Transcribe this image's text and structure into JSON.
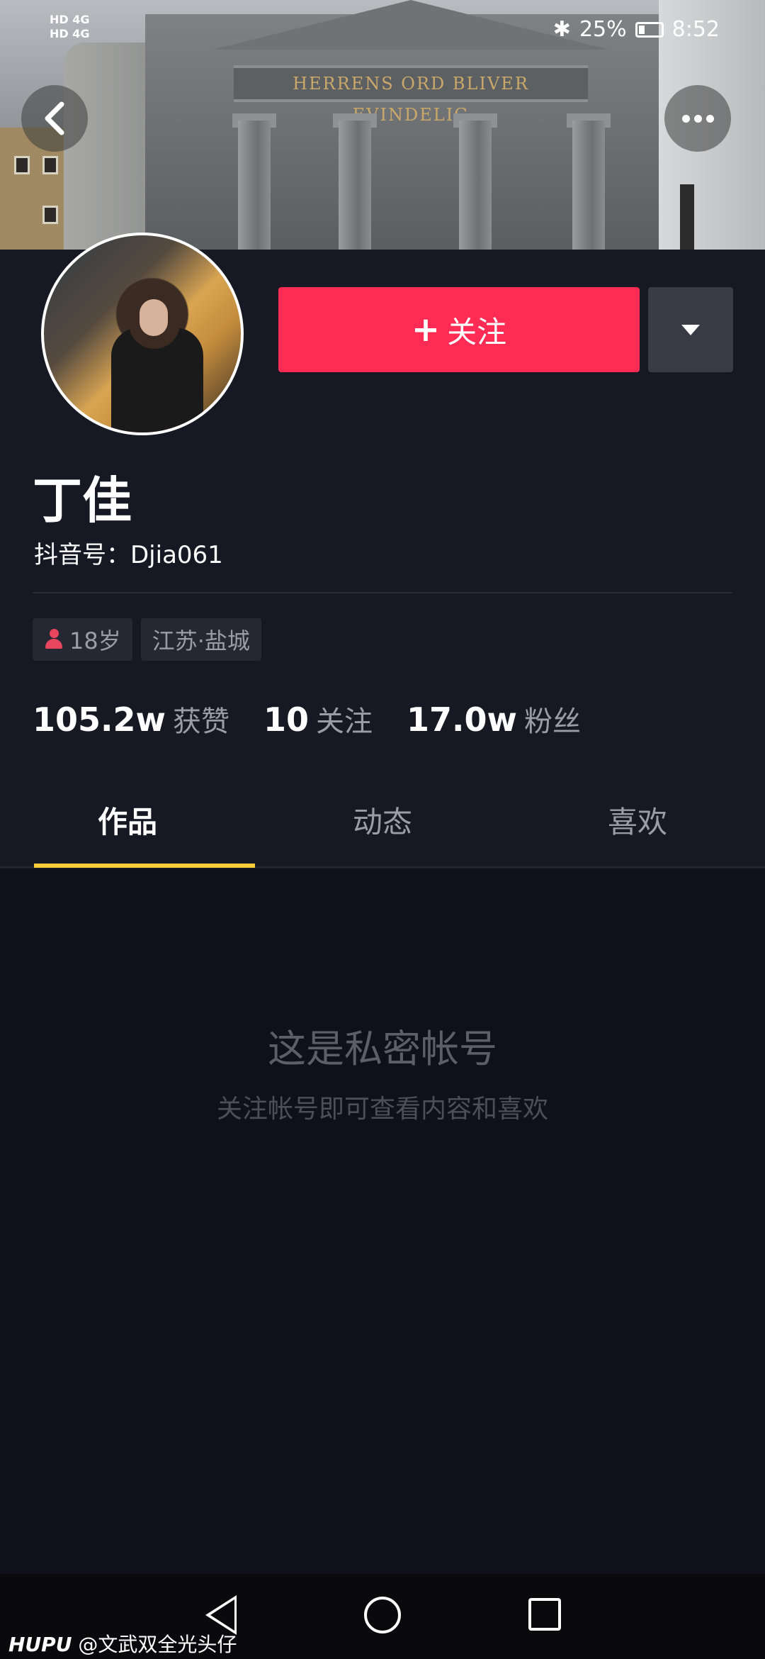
{
  "status_bar": {
    "network_top": "HD 4G",
    "network_bottom": "HD 4G",
    "battery": "25%",
    "time": "8:52"
  },
  "banner": {
    "inscription": "HERRENS ORD BLIVER EVINDELIG"
  },
  "profile": {
    "name": "丁佳",
    "douyin_id": "抖音号：Djia061",
    "follow_label": "关注",
    "tags": {
      "age": "18岁",
      "location": "江苏·盐城"
    },
    "stats": {
      "likes_num": "105.2w",
      "likes_label": "获赞",
      "following_num": "10",
      "following_label": "关注",
      "followers_num": "17.0w",
      "followers_label": "粉丝"
    }
  },
  "tabs": {
    "works": "作品",
    "dynamic": "动态",
    "likes": "喜欢"
  },
  "private": {
    "title": "这是私密帐号",
    "subtitle": "关注帐号即可查看内容和喜欢"
  },
  "watermark": {
    "brand": "HUPU",
    "handle": "@文武双全光头仔"
  },
  "colors": {
    "accent": "#fe2c55",
    "tab_indicator": "#facd3c",
    "background": "#161823"
  },
  "icons": [
    "back-icon",
    "more-icon",
    "dropdown-icon",
    "plus-icon",
    "person-icon",
    "nav-back-icon",
    "nav-home-icon",
    "nav-recent-icon",
    "wifi-icon",
    "bluetooth-icon",
    "battery-icon"
  ]
}
